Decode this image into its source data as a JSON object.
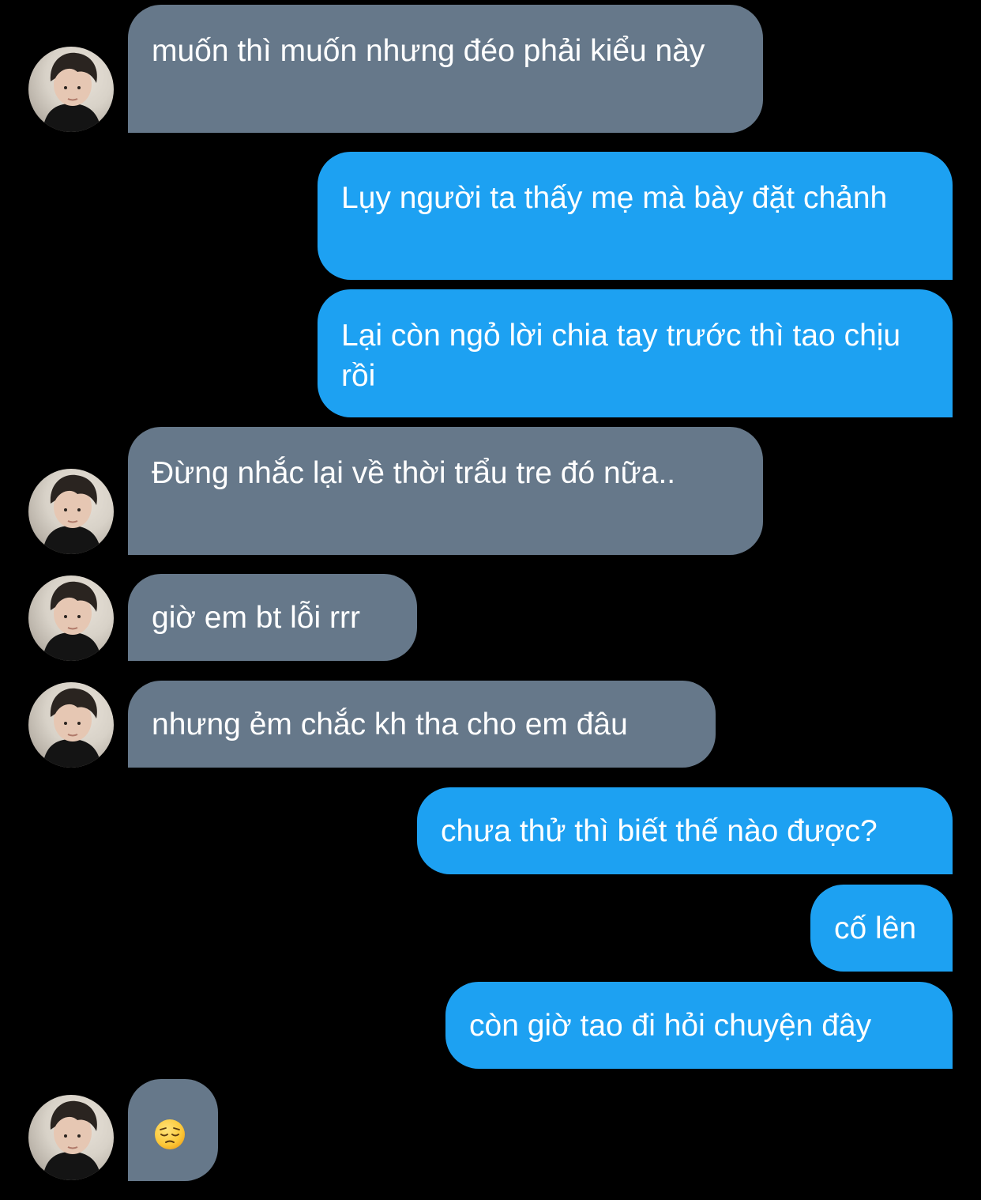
{
  "colors": {
    "background": "#000000",
    "incoming_bubble": "#66788a",
    "outgoing_bubble": "#1da1f2",
    "text": "#ffffff"
  },
  "messages": [
    {
      "sender": "them",
      "text": "muốn thì muốn nhưng đéo phải kiểu này"
    },
    {
      "sender": "me",
      "text": "Lụy người ta thấy mẹ mà bày đặt chảnh"
    },
    {
      "sender": "me",
      "text": "Lại còn ngỏ lời chia tay trước thì tao chịu rồi"
    },
    {
      "sender": "them",
      "text": "Đừng nhắc lại về thời trẩu tre đó nữa.."
    },
    {
      "sender": "them",
      "text": "giờ em bt lỗi rrr"
    },
    {
      "sender": "them",
      "text": "nhưng ẻm chắc kh tha cho em đâu"
    },
    {
      "sender": "me",
      "text": "chưa thử thì biết thế nào được?"
    },
    {
      "sender": "me",
      "text": "cố lên"
    },
    {
      "sender": "me",
      "text": "còn giờ tao đi hỏi chuyện đây"
    },
    {
      "sender": "them",
      "emoji": "pensive-face-icon"
    }
  ]
}
